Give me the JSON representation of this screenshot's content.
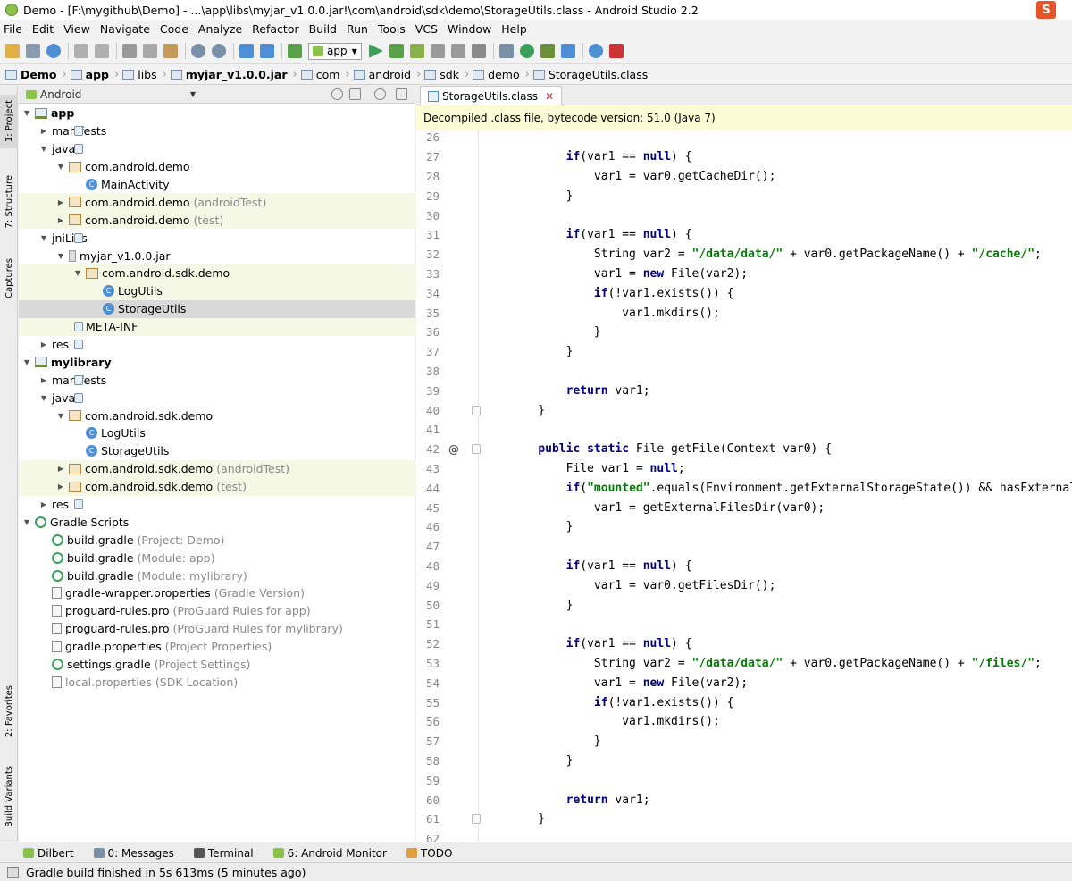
{
  "window": {
    "title": "Demo - [F:\\mygithub\\Demo] - ...\\app\\libs\\myjar_v1.0.0.jar!\\com\\android\\sdk\\demo\\StorageUtils.class - Android Studio 2.2",
    "ime_badge": "S"
  },
  "menu": [
    "File",
    "Edit",
    "View",
    "Navigate",
    "Code",
    "Analyze",
    "Refactor",
    "Build",
    "Run",
    "Tools",
    "VCS",
    "Window",
    "Help"
  ],
  "toolbar": {
    "run_config": "app"
  },
  "breadcrumbs": [
    "Demo",
    "app",
    "libs",
    "myjar_v1.0.0.jar",
    "com",
    "android",
    "sdk",
    "demo",
    "StorageUtils.class"
  ],
  "left_tabs": [
    "1: Project",
    "7: Structure",
    "Captures",
    "2: Favorites",
    "Build Variants"
  ],
  "project": {
    "view_mode": "Android",
    "tree": [
      {
        "indent": 0,
        "arrow": "▼",
        "icon": "mod",
        "label": "app",
        "bold": true,
        "hint": ""
      },
      {
        "indent": 1,
        "arrow": "▶",
        "icon": "fold",
        "label": "manifests",
        "hint": ""
      },
      {
        "indent": 1,
        "arrow": "▼",
        "icon": "fold",
        "label": "java",
        "hint": ""
      },
      {
        "indent": 2,
        "arrow": "▼",
        "icon": "pkg",
        "label": "com.android.demo",
        "hint": ""
      },
      {
        "indent": 3,
        "arrow": "",
        "icon": "cls",
        "label": "MainActivity",
        "hint": ""
      },
      {
        "indent": 2,
        "arrow": "▶",
        "icon": "pkg",
        "label": "com.android.demo",
        "hint": "(androidTest)",
        "hl": true
      },
      {
        "indent": 2,
        "arrow": "▶",
        "icon": "pkg",
        "label": "com.android.demo",
        "hint": "(test)",
        "hl": true
      },
      {
        "indent": 1,
        "arrow": "▼",
        "icon": "fold",
        "label": "jniLibs",
        "hint": ""
      },
      {
        "indent": 2,
        "arrow": "▼",
        "icon": "jar",
        "label": "myjar_v1.0.0.jar",
        "hint": ""
      },
      {
        "indent": 3,
        "arrow": "▼",
        "icon": "pkg",
        "label": "com.android.sdk.demo",
        "hint": "",
        "hl": true
      },
      {
        "indent": 4,
        "arrow": "",
        "icon": "cls",
        "label": "LogUtils",
        "hint": "",
        "hl": true
      },
      {
        "indent": 4,
        "arrow": "",
        "icon": "cls",
        "label": "StorageUtils",
        "hint": "",
        "sel": true
      },
      {
        "indent": 3,
        "arrow": "▶",
        "icon": "fold",
        "label": "META-INF",
        "hint": "",
        "hl": true
      },
      {
        "indent": 1,
        "arrow": "▶",
        "icon": "fold",
        "label": "res",
        "hint": ""
      },
      {
        "indent": 0,
        "arrow": "▼",
        "icon": "mod",
        "label": "mylibrary",
        "bold": true,
        "hint": ""
      },
      {
        "indent": 1,
        "arrow": "▶",
        "icon": "fold",
        "label": "manifests",
        "hint": ""
      },
      {
        "indent": 1,
        "arrow": "▼",
        "icon": "fold",
        "label": "java",
        "hint": ""
      },
      {
        "indent": 2,
        "arrow": "▼",
        "icon": "pkg",
        "label": "com.android.sdk.demo",
        "hint": ""
      },
      {
        "indent": 3,
        "arrow": "",
        "icon": "cls",
        "label": "LogUtils",
        "hint": ""
      },
      {
        "indent": 3,
        "arrow": "",
        "icon": "cls",
        "label": "StorageUtils",
        "hint": ""
      },
      {
        "indent": 2,
        "arrow": "▶",
        "icon": "pkg",
        "label": "com.android.sdk.demo",
        "hint": "(androidTest)",
        "hl": true
      },
      {
        "indent": 2,
        "arrow": "▶",
        "icon": "pkg",
        "label": "com.android.sdk.demo",
        "hint": "(test)",
        "hl": true
      },
      {
        "indent": 1,
        "arrow": "▶",
        "icon": "fold",
        "label": "res",
        "hint": ""
      },
      {
        "indent": 0,
        "arrow": "▼",
        "icon": "gr",
        "label": "Gradle Scripts",
        "hint": ""
      },
      {
        "indent": 1,
        "arrow": "",
        "icon": "gr",
        "label": "build.gradle",
        "hint": "(Project: Demo)"
      },
      {
        "indent": 1,
        "arrow": "",
        "icon": "gr",
        "label": "build.gradle",
        "hint": "(Module: app)"
      },
      {
        "indent": 1,
        "arrow": "",
        "icon": "gr",
        "label": "build.gradle",
        "hint": "(Module: mylibrary)"
      },
      {
        "indent": 1,
        "arrow": "",
        "icon": "prop",
        "label": "gradle-wrapper.properties",
        "hint": "(Gradle Version)"
      },
      {
        "indent": 1,
        "arrow": "",
        "icon": "prop",
        "label": "proguard-rules.pro",
        "hint": "(ProGuard Rules for app)"
      },
      {
        "indent": 1,
        "arrow": "",
        "icon": "prop",
        "label": "proguard-rules.pro",
        "hint": "(ProGuard Rules for mylibrary)"
      },
      {
        "indent": 1,
        "arrow": "",
        "icon": "prop",
        "label": "gradle.properties",
        "hint": "(Project Properties)"
      },
      {
        "indent": 1,
        "arrow": "",
        "icon": "gr",
        "label": "settings.gradle",
        "hint": "(Project Settings)"
      },
      {
        "indent": 1,
        "arrow": "",
        "icon": "prop",
        "label": "local.properties",
        "hint": "(SDK Location)",
        "dim": true
      }
    ]
  },
  "editor": {
    "tab": "StorageUtils.class",
    "banner": "Decompiled .class file, bytecode version: 51.0 (Java 7)",
    "lines": [
      {
        "n": "26",
        "t": ""
      },
      {
        "n": "27",
        "t": "        <span class=\"kw\">if</span>(var1 == <span class=\"kw\">null</span>) {"
      },
      {
        "n": "28",
        "t": "            var1 = var0.getCacheDir();"
      },
      {
        "n": "29",
        "t": "        }"
      },
      {
        "n": "30",
        "t": ""
      },
      {
        "n": "31",
        "t": "        <span class=\"kw\">if</span>(var1 == <span class=\"kw\">null</span>) {"
      },
      {
        "n": "32",
        "t": "            String var2 = <span class=\"str\">\"/data/data/\"</span> + var0.getPackageName() + <span class=\"str\">\"/cache/\"</span>;"
      },
      {
        "n": "33",
        "t": "            var1 = <span class=\"kw\">new</span> File(var2);"
      },
      {
        "n": "34",
        "t": "            <span class=\"kw\">if</span>(!var1.exists()) {"
      },
      {
        "n": "35",
        "t": "                var1.mkdirs();"
      },
      {
        "n": "36",
        "t": "            }"
      },
      {
        "n": "37",
        "t": "        }"
      },
      {
        "n": "38",
        "t": ""
      },
      {
        "n": "39",
        "t": "        <span class=\"kw\">return</span> var1;"
      },
      {
        "n": "40",
        "t": "    }",
        "fold": true
      },
      {
        "n": "41",
        "t": ""
      },
      {
        "n": "42",
        "t": "    <span class=\"kw\">public static</span> File getFile(Context var0) {",
        "fold": true,
        "ovr": "@"
      },
      {
        "n": "43",
        "t": "        File var1 = <span class=\"kw\">null</span>;"
      },
      {
        "n": "44",
        "t": "        <span class=\"kw\">if</span>(<span class=\"str\">\"mounted\"</span>.equals(Environment.getExternalStorageState()) &amp;&amp; hasExternalStora"
      },
      {
        "n": "45",
        "t": "            var1 = getExternalFilesDir(var0);"
      },
      {
        "n": "46",
        "t": "        }"
      },
      {
        "n": "47",
        "t": ""
      },
      {
        "n": "48",
        "t": "        <span class=\"kw\">if</span>(var1 == <span class=\"kw\">null</span>) {"
      },
      {
        "n": "49",
        "t": "            var1 = var0.getFilesDir();"
      },
      {
        "n": "50",
        "t": "        }"
      },
      {
        "n": "51",
        "t": ""
      },
      {
        "n": "52",
        "t": "        <span class=\"kw\">if</span>(var1 == <span class=\"kw\">null</span>) {"
      },
      {
        "n": "53",
        "t": "            String var2 = <span class=\"str\">\"/data/data/\"</span> + var0.getPackageName() + <span class=\"str\">\"/files/\"</span>;"
      },
      {
        "n": "54",
        "t": "            var1 = <span class=\"kw\">new</span> File(var2);"
      },
      {
        "n": "55",
        "t": "            <span class=\"kw\">if</span>(!var1.exists()) {"
      },
      {
        "n": "56",
        "t": "                var1.mkdirs();"
      },
      {
        "n": "57",
        "t": "            }"
      },
      {
        "n": "58",
        "t": "        }"
      },
      {
        "n": "59",
        "t": ""
      },
      {
        "n": "60",
        "t": "        <span class=\"kw\">return</span> var1;"
      },
      {
        "n": "61",
        "t": "    }",
        "fold": true
      },
      {
        "n": "62",
        "t": ""
      }
    ]
  },
  "bottom_tabs": [
    "Dilbert",
    "0: Messages",
    "Terminal",
    "6: Android Monitor",
    "TODO"
  ],
  "status": "Gradle build finished in 5s 613ms (5 minutes ago)",
  "colors": {
    "keyword": "#000080",
    "string": "#008000",
    "highlight_row": "#f6f8e6",
    "selected_row": "#d9d9d9",
    "banner": "#fdfbd6"
  }
}
